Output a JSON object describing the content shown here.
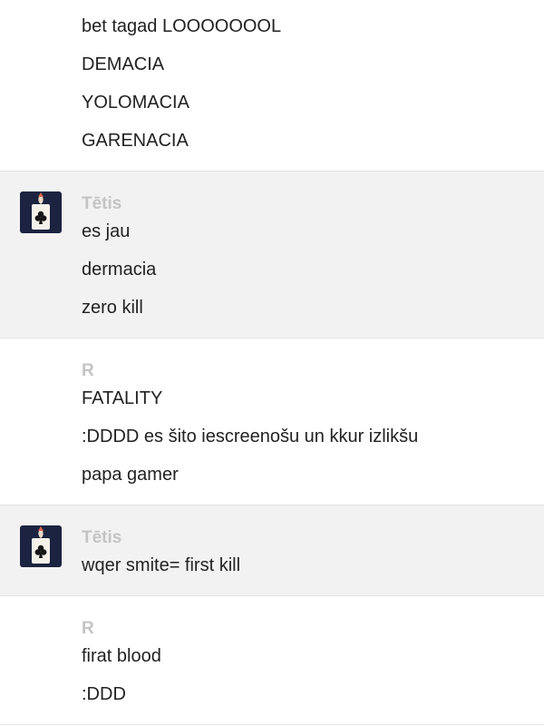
{
  "top_messages": [
    "bet tagad LOOOOOOOL",
    "DEMACIA",
    "YOLOMACIA",
    "GARENACIA"
  ],
  "groups": [
    {
      "sender": "Tētis",
      "avatar": "playing-card-avatar-icon",
      "messages": [
        "es jau",
        "dermacia",
        "zero kill"
      ]
    },
    {
      "sender": "R",
      "messages": [
        "FATALITY",
        ":DDDD es šito iescreenošu un kkur izlikšu",
        "papa gamer"
      ]
    },
    {
      "sender": "Tētis",
      "avatar": "playing-card-avatar-icon",
      "messages": [
        "wqer smite= first kill"
      ]
    },
    {
      "sender": "R",
      "messages": [
        "firat blood",
        ":DDD"
      ]
    }
  ],
  "colors": {
    "shaded_background": "#f2f2f2",
    "sender_name": "#c4c4c4",
    "message_text": "#222222",
    "divider": "#e2e2e2",
    "avatar_background": "#1b2340"
  }
}
